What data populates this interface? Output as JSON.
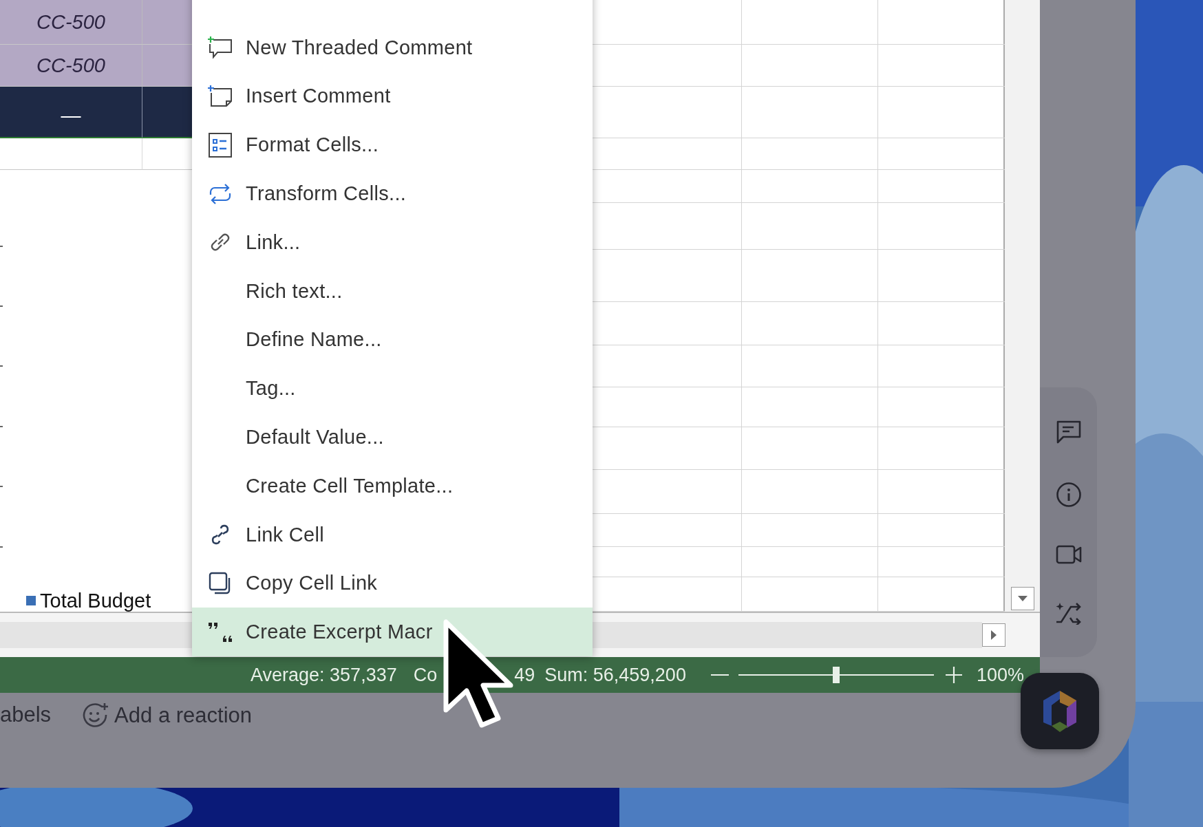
{
  "sheet": {
    "rows": [
      {
        "kind": "data",
        "code": "CC-500"
      },
      {
        "kind": "data",
        "code": "CC-500"
      },
      {
        "kind": "total",
        "code": "—"
      }
    ]
  },
  "chart": {
    "legend": [
      {
        "label": "Total Budget",
        "color": "#3a6fb5"
      }
    ]
  },
  "context_menu": {
    "items": [
      {
        "label": "New Threaded Comment",
        "selected": false
      },
      {
        "label": "Insert Comment",
        "selected": false
      },
      {
        "label": "Format Cells...",
        "selected": false
      },
      {
        "label": "Transform Cells...",
        "selected": false
      },
      {
        "label": "Link...",
        "selected": false
      },
      {
        "label": "Rich text...",
        "selected": false
      },
      {
        "label": "Define Name...",
        "selected": false
      },
      {
        "label": "Tag...",
        "selected": false
      },
      {
        "label": "Default Value...",
        "selected": false
      },
      {
        "label": "Create Cell Template...",
        "selected": false
      },
      {
        "label": "Link Cell",
        "selected": false
      },
      {
        "label": "Copy Cell Link",
        "selected": false
      },
      {
        "label": "Create Excerpt Macr",
        "selected": true
      }
    ]
  },
  "status_bar": {
    "average": "Average: 357,337",
    "count_parts": [
      "Co",
      "49"
    ],
    "sum": "Sum: 56,459,200",
    "zoom": {
      "level": 0.5
    },
    "zoom_label": "100%"
  },
  "footer": {
    "labels_text": "abels",
    "reaction": "Add a reaction"
  }
}
